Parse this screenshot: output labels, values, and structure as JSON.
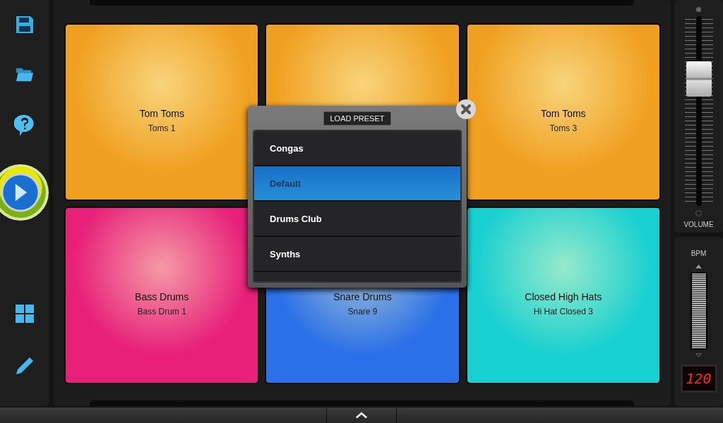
{
  "sidebar": {
    "items": [
      {
        "kind": "save"
      },
      {
        "kind": "open"
      },
      {
        "kind": "help"
      },
      {
        "kind": "play"
      },
      {
        "kind": "grid"
      },
      {
        "kind": "edit"
      }
    ]
  },
  "pads": [
    {
      "name": "Tom Toms",
      "sound": "Toms 1",
      "color": "#f0a020"
    },
    {
      "color": "#f0a020"
    },
    {
      "name": "Tom Toms",
      "sound": "Toms 3",
      "color": "#f0a020"
    },
    {
      "name": "Bass Drums",
      "sound": "Bass Drum 1",
      "color": "#e8207a"
    },
    {
      "name": "Snare Drums",
      "sound": "Snare 9",
      "color": "#2a70e8"
    },
    {
      "name": "Closed High Hats",
      "sound": "Hi Hat Closed 3",
      "color": "#18d0d0"
    }
  ],
  "dialog": {
    "title": "LOAD PRESET",
    "items": [
      {
        "label": "Congas",
        "selected": false
      },
      {
        "label": "Default",
        "selected": true
      },
      {
        "label": "Drums Club",
        "selected": false
      },
      {
        "label": "Synths",
        "selected": false
      }
    ]
  },
  "volume": {
    "label": "VOLUME",
    "level": 0.67
  },
  "bpm": {
    "label": "BPM",
    "value": "120"
  }
}
